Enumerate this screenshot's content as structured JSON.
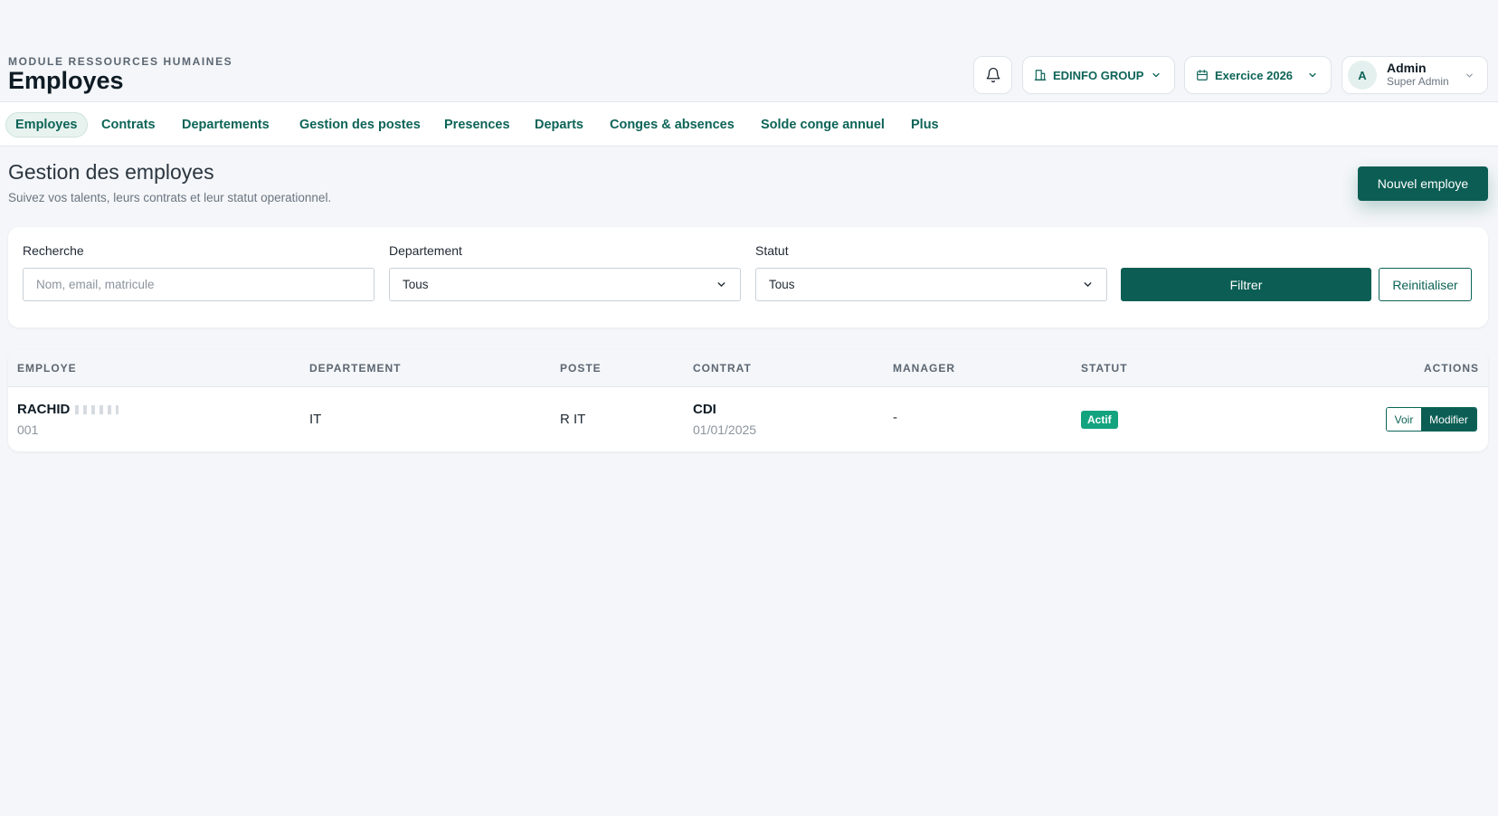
{
  "header": {
    "module_label": "MODULE RESSOURCES HUMAINES",
    "page_title": "Employes",
    "company": "EDINFO GROUP",
    "year": "Exercice 2026",
    "user": {
      "initial": "A",
      "name": "Admin",
      "role": "Super Admin"
    },
    "icons": {
      "bell": "bell-icon",
      "company": "building-icon",
      "year": "calendar-icon",
      "chevron": "chevron-down-icon"
    }
  },
  "tabs": [
    {
      "label": "Employes",
      "active": true
    },
    {
      "label": "Contrats",
      "active": false
    },
    {
      "label": "Departements",
      "active": false
    },
    {
      "label": "Gestion des postes",
      "active": false
    },
    {
      "label": "Presences",
      "active": false
    },
    {
      "label": "Departs",
      "active": false
    },
    {
      "label": "Conges & absences",
      "active": false
    },
    {
      "label": "Solde conge annuel",
      "active": false
    },
    {
      "label": "Plus",
      "active": false
    }
  ],
  "section": {
    "title": "Gestion des employes",
    "subtitle": "Suivez vos talents, leurs contrats et leur statut operationnel.",
    "new_button": "Nouvel employe"
  },
  "filters": {
    "search": {
      "label": "Recherche",
      "placeholder": "Nom, email, matricule",
      "value": ""
    },
    "department": {
      "label": "Departement",
      "value": "Tous"
    },
    "status": {
      "label": "Statut",
      "value": "Tous"
    },
    "filter_button": "Filtrer",
    "reset_button": "Reinitialiser"
  },
  "table": {
    "columns": [
      "EMPLOYE",
      "DEPARTEMENT",
      "POSTE",
      "CONTRAT",
      "MANAGER",
      "STATUT",
      "ACTIONS"
    ],
    "rows": [
      {
        "name": "RACHID",
        "matricule": "001",
        "department": "IT",
        "position": "R IT",
        "contract_type": "CDI",
        "contract_date": "01/01/2025",
        "manager": "-",
        "status": "Actif",
        "view_label": "Voir",
        "edit_label": "Modifier"
      }
    ]
  },
  "colors": {
    "primary": "#0c5e54",
    "accent_text": "#0d6457",
    "status_active": "#14a37f",
    "background": "#f4f6f9"
  }
}
